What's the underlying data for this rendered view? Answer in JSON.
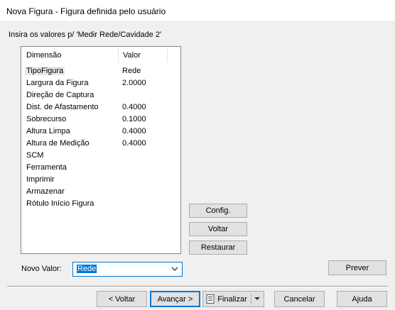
{
  "window": {
    "title": "Nova Figura - Figura definida pelo usuário"
  },
  "instruction": "Insira os valores p/ 'Medir Rede/Cavidade 2'",
  "table": {
    "columns": [
      "Dimensão",
      "Valor"
    ],
    "rows": [
      {
        "name": "TipoFigura",
        "value": "Rede"
      },
      {
        "name": "Largura da Figura",
        "value": "2.0000"
      },
      {
        "name": "Direção de Captura",
        "value": ""
      },
      {
        "name": "Dist. de Afastamento",
        "value": "0.4000"
      },
      {
        "name": "Sobrecurso",
        "value": "0.1000"
      },
      {
        "name": "Altura Limpa",
        "value": "0.4000"
      },
      {
        "name": "Altura de Medição",
        "value": "0.4000"
      },
      {
        "name": "SCM",
        "value": ""
      },
      {
        "name": "Ferramenta",
        "value": ""
      },
      {
        "name": "Imprimir",
        "value": ""
      },
      {
        "name": "Armazenar",
        "value": ""
      },
      {
        "name": "Rótulo Início Figura",
        "value": ""
      }
    ],
    "selected_row": "TipoFigura"
  },
  "side_buttons": {
    "config": "Config.",
    "voltar": "Voltar",
    "restaurar": "Restaurar",
    "prever": "Prever"
  },
  "novo_valor": {
    "label": "Novo Valor:",
    "value": "Rede"
  },
  "footer": {
    "back": "< Voltar",
    "next": "Avançar >",
    "finish": "Finalizar",
    "cancel": "Cancelar",
    "help": "Ajuda"
  },
  "colors": {
    "accent": "#0078d7",
    "button_bg": "#e1e1e1",
    "dialog_bg": "#f0f0f0"
  }
}
